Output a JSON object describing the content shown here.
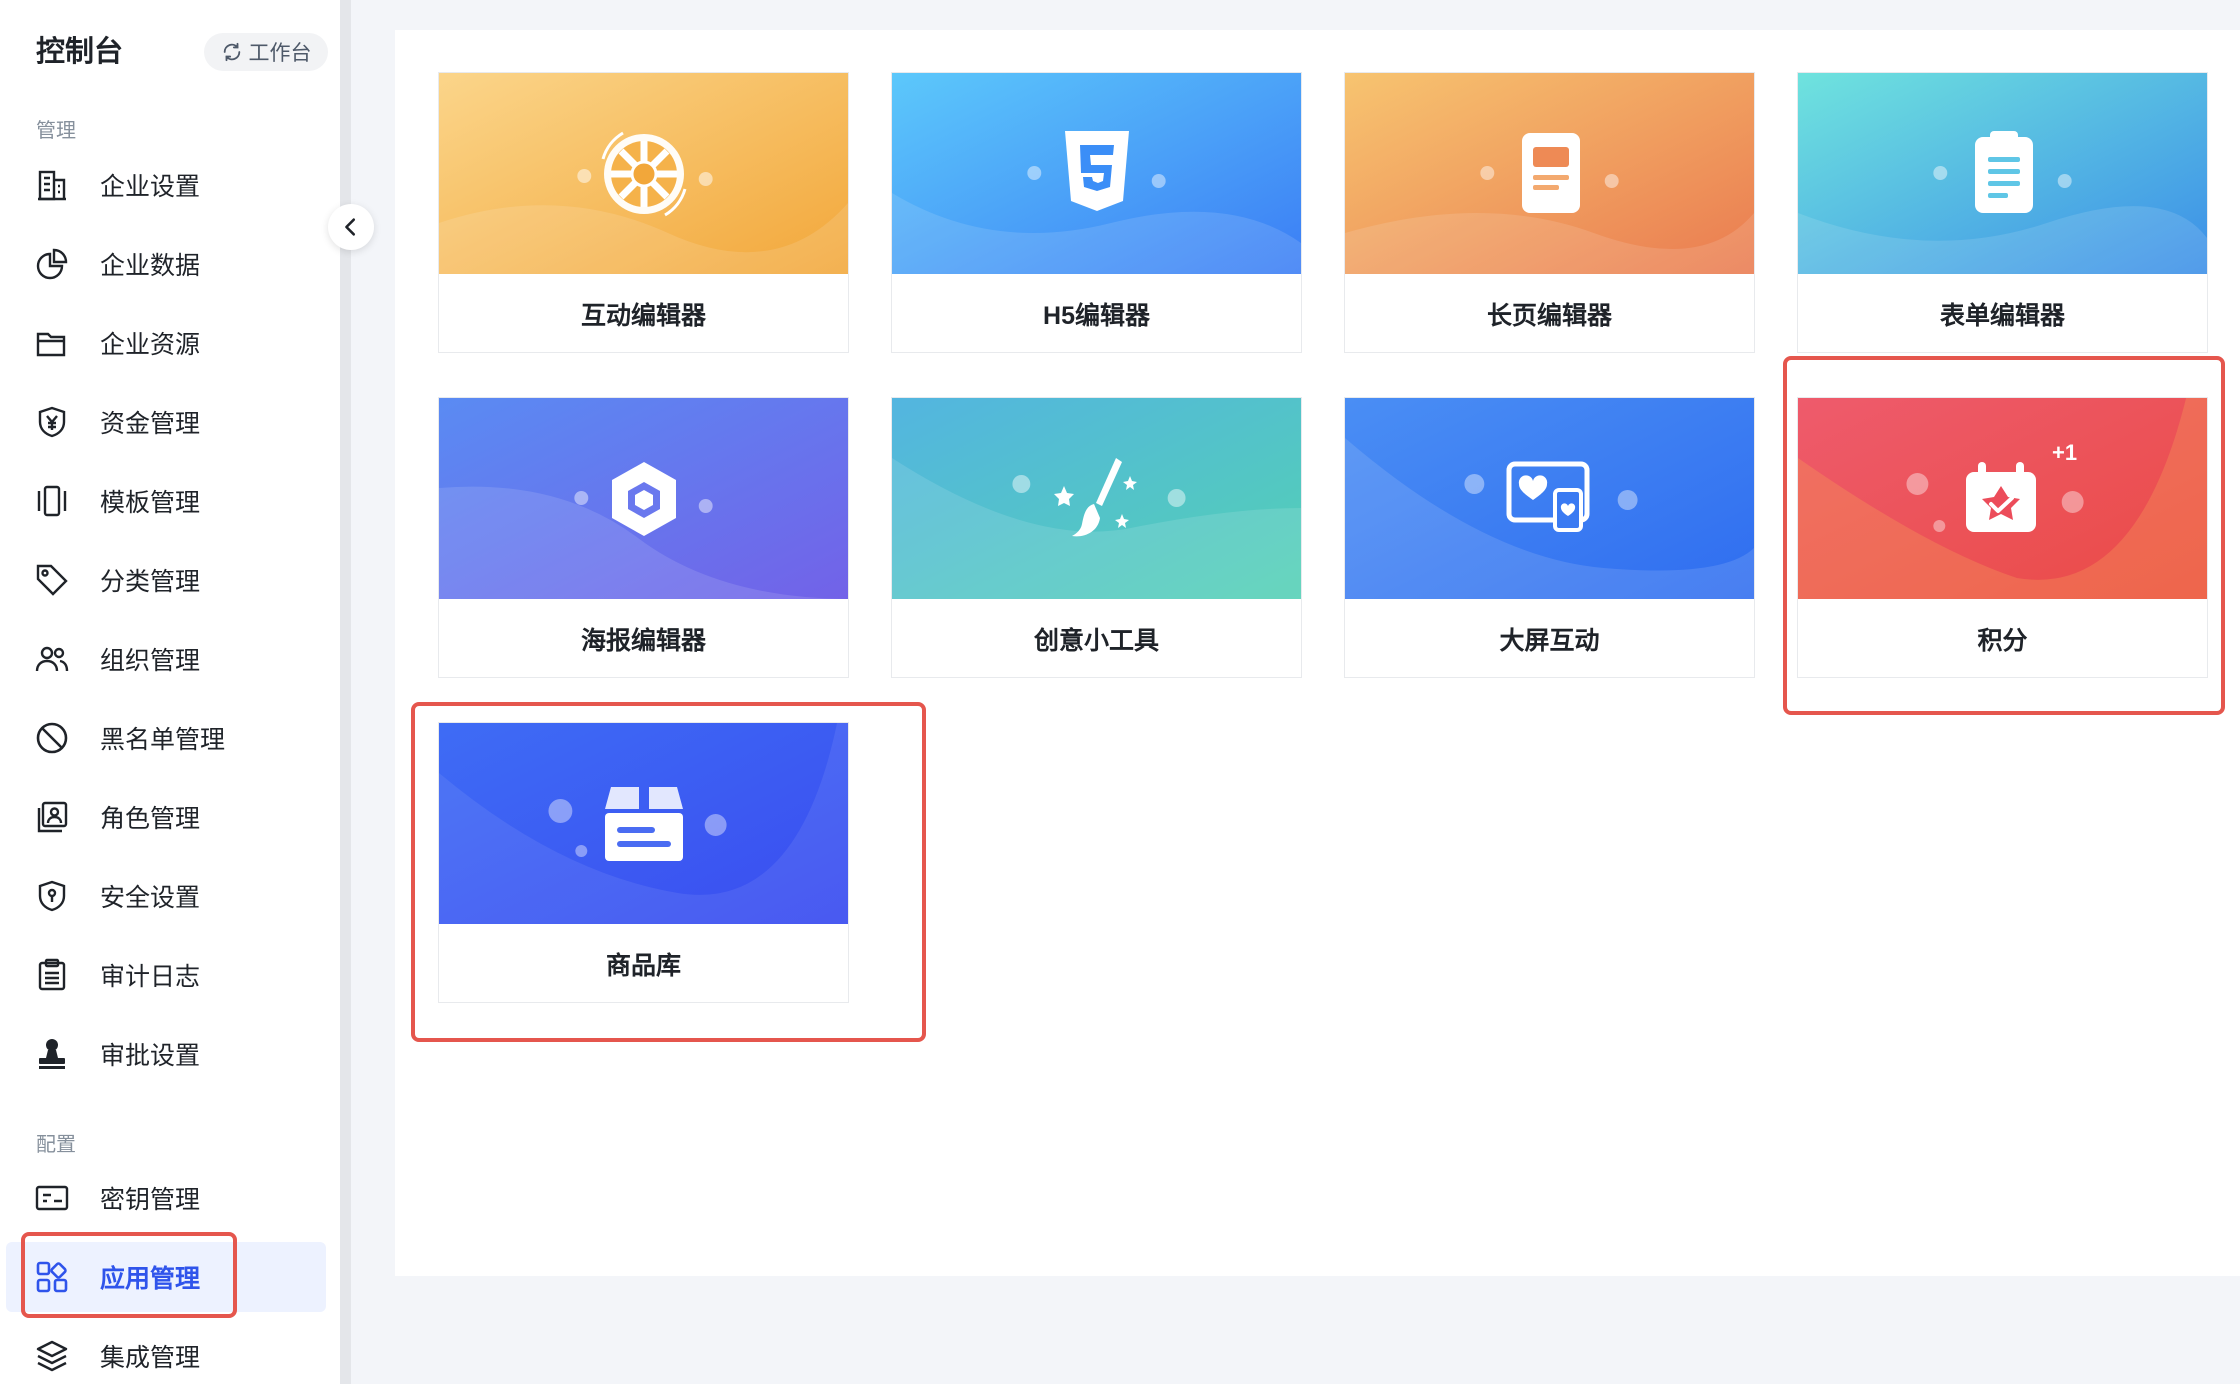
{
  "sidebar": {
    "title": "控制台",
    "workbench_label": "工作台",
    "groups": {
      "manage": "管理",
      "config": "配置"
    },
    "items": [
      {
        "label": "企业设置",
        "icon": "building-icon"
      },
      {
        "label": "企业数据",
        "icon": "pie-chart-icon"
      },
      {
        "label": "企业资源",
        "icon": "folder-icon"
      },
      {
        "label": "资金管理",
        "icon": "shield-yuan-icon"
      },
      {
        "label": "模板管理",
        "icon": "template-icon"
      },
      {
        "label": "分类管理",
        "icon": "tag-icon"
      },
      {
        "label": "组织管理",
        "icon": "users-icon"
      },
      {
        "label": "黑名单管理",
        "icon": "ban-icon"
      },
      {
        "label": "角色管理",
        "icon": "role-icon"
      },
      {
        "label": "安全设置",
        "icon": "shield-keyhole-icon"
      },
      {
        "label": "审计日志",
        "icon": "clipboard-icon"
      },
      {
        "label": "审批设置",
        "icon": "stamp-icon"
      }
    ],
    "config_items": [
      {
        "label": "密钥管理",
        "icon": "key-card-icon"
      },
      {
        "label": "应用管理",
        "icon": "apps-icon",
        "active": true
      },
      {
        "label": "集成管理",
        "icon": "layers-icon"
      }
    ]
  },
  "apps": [
    {
      "label": "互动编辑器",
      "icon": "wheel-icon"
    },
    {
      "label": "H5编辑器",
      "icon": "html5-icon"
    },
    {
      "label": "长页编辑器",
      "icon": "long-page-icon"
    },
    {
      "label": "表单编辑器",
      "icon": "form-icon"
    },
    {
      "label": "海报编辑器",
      "icon": "poster-icon"
    },
    {
      "label": "创意小工具",
      "icon": "brush-stars-icon"
    },
    {
      "label": "大屏互动",
      "icon": "screen-heart-icon"
    },
    {
      "label": "积分",
      "icon": "points-calendar-icon",
      "badge": "+1"
    },
    {
      "label": "商品库",
      "icon": "product-box-icon"
    }
  ],
  "colors": {
    "accent": "#2f54eb",
    "highlight": "#e5564d"
  }
}
